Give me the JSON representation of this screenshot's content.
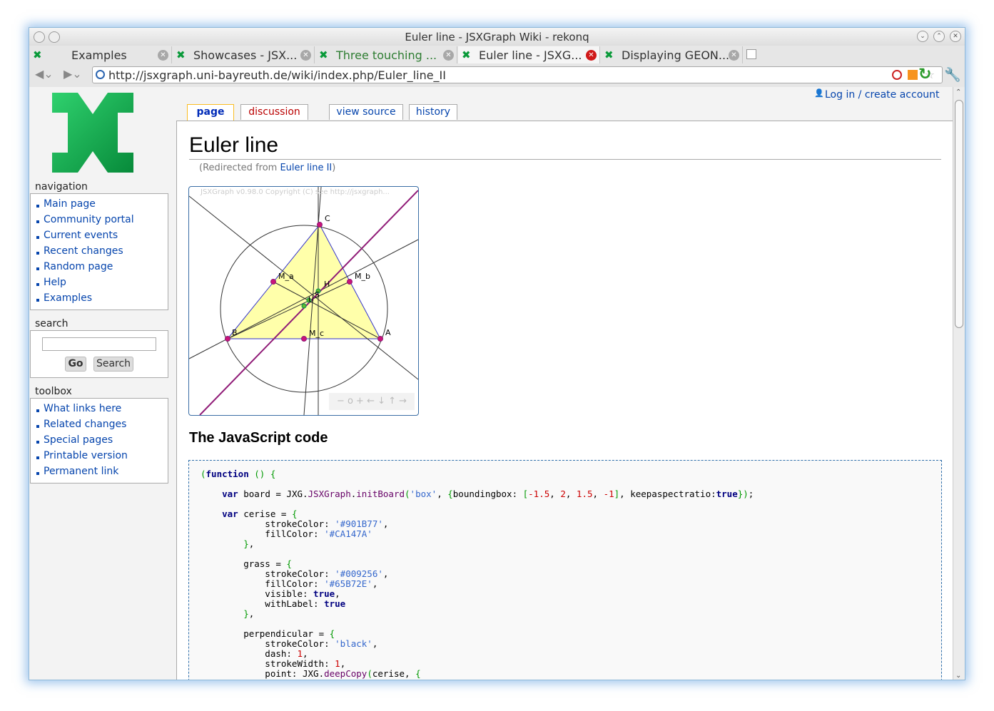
{
  "window": {
    "title": "Euler line - JSXGraph Wiki - rekonq"
  },
  "tabs": [
    {
      "label": "Examples"
    },
    {
      "label": "Showcases - JSX..."
    },
    {
      "label": "Three touching ..."
    },
    {
      "label": "Euler line - JSXG..."
    },
    {
      "label": "Displaying GEON..."
    }
  ],
  "url": "http://jsxgraph.uni-bayreuth.de/wiki/index.php/Euler_line_II",
  "personal": {
    "login": "Log in / create account"
  },
  "content_tabs": {
    "page": "page",
    "discussion": "discussion",
    "view_source": "view source",
    "history": "history"
  },
  "sidebar": {
    "navigation_title": "navigation",
    "navigation": [
      "Main page",
      "Community portal",
      "Current events",
      "Recent changes",
      "Random page",
      "Help",
      "Examples"
    ],
    "search_title": "search",
    "go": "Go",
    "search": "Search",
    "toolbox_title": "toolbox",
    "toolbox": [
      "What links here",
      "Related changes",
      "Special pages",
      "Printable version",
      "Permanent link"
    ]
  },
  "article": {
    "title": "Euler line",
    "redirect_prefix": "(Redirected from ",
    "redirect_link": "Euler line II",
    "redirect_suffix": ")",
    "section_title": "The JavaScript code"
  },
  "board": {
    "copyright": "JSXGraph v0.98.0 Copyright (C) see http://jsxgraph...",
    "labels": {
      "A": "A",
      "B": "B",
      "C": "C",
      "Ma": "M_a",
      "Mb": "M_b",
      "Mc": "M_c",
      "H": "H",
      "S": "S",
      "U": "U"
    },
    "nav": "− o + ← ↓ ↑ →"
  },
  "code_lines": [
    "(function () {",
    "",
    "    var board = JXG.JSXGraph.initBoard('box', {boundingbox: [-1.5, 2, 1.5, -1], keepaspectratio:true});",
    "",
    "    var cerise = {",
    "            strokeColor: '#901B77',",
    "            fillColor: '#CA147A'",
    "        },",
    "",
    "        grass = {",
    "            strokeColor: '#009256',",
    "            fillColor: '#65B72E',",
    "            visible: true,",
    "            withLabel: true",
    "        },",
    "",
    "        perpendicular = {",
    "            strokeColor: 'black',",
    "            dash: 1,",
    "            strokeWidth: 1,",
    "            point: JXG.deepCopy(cerise, {"
  ]
}
